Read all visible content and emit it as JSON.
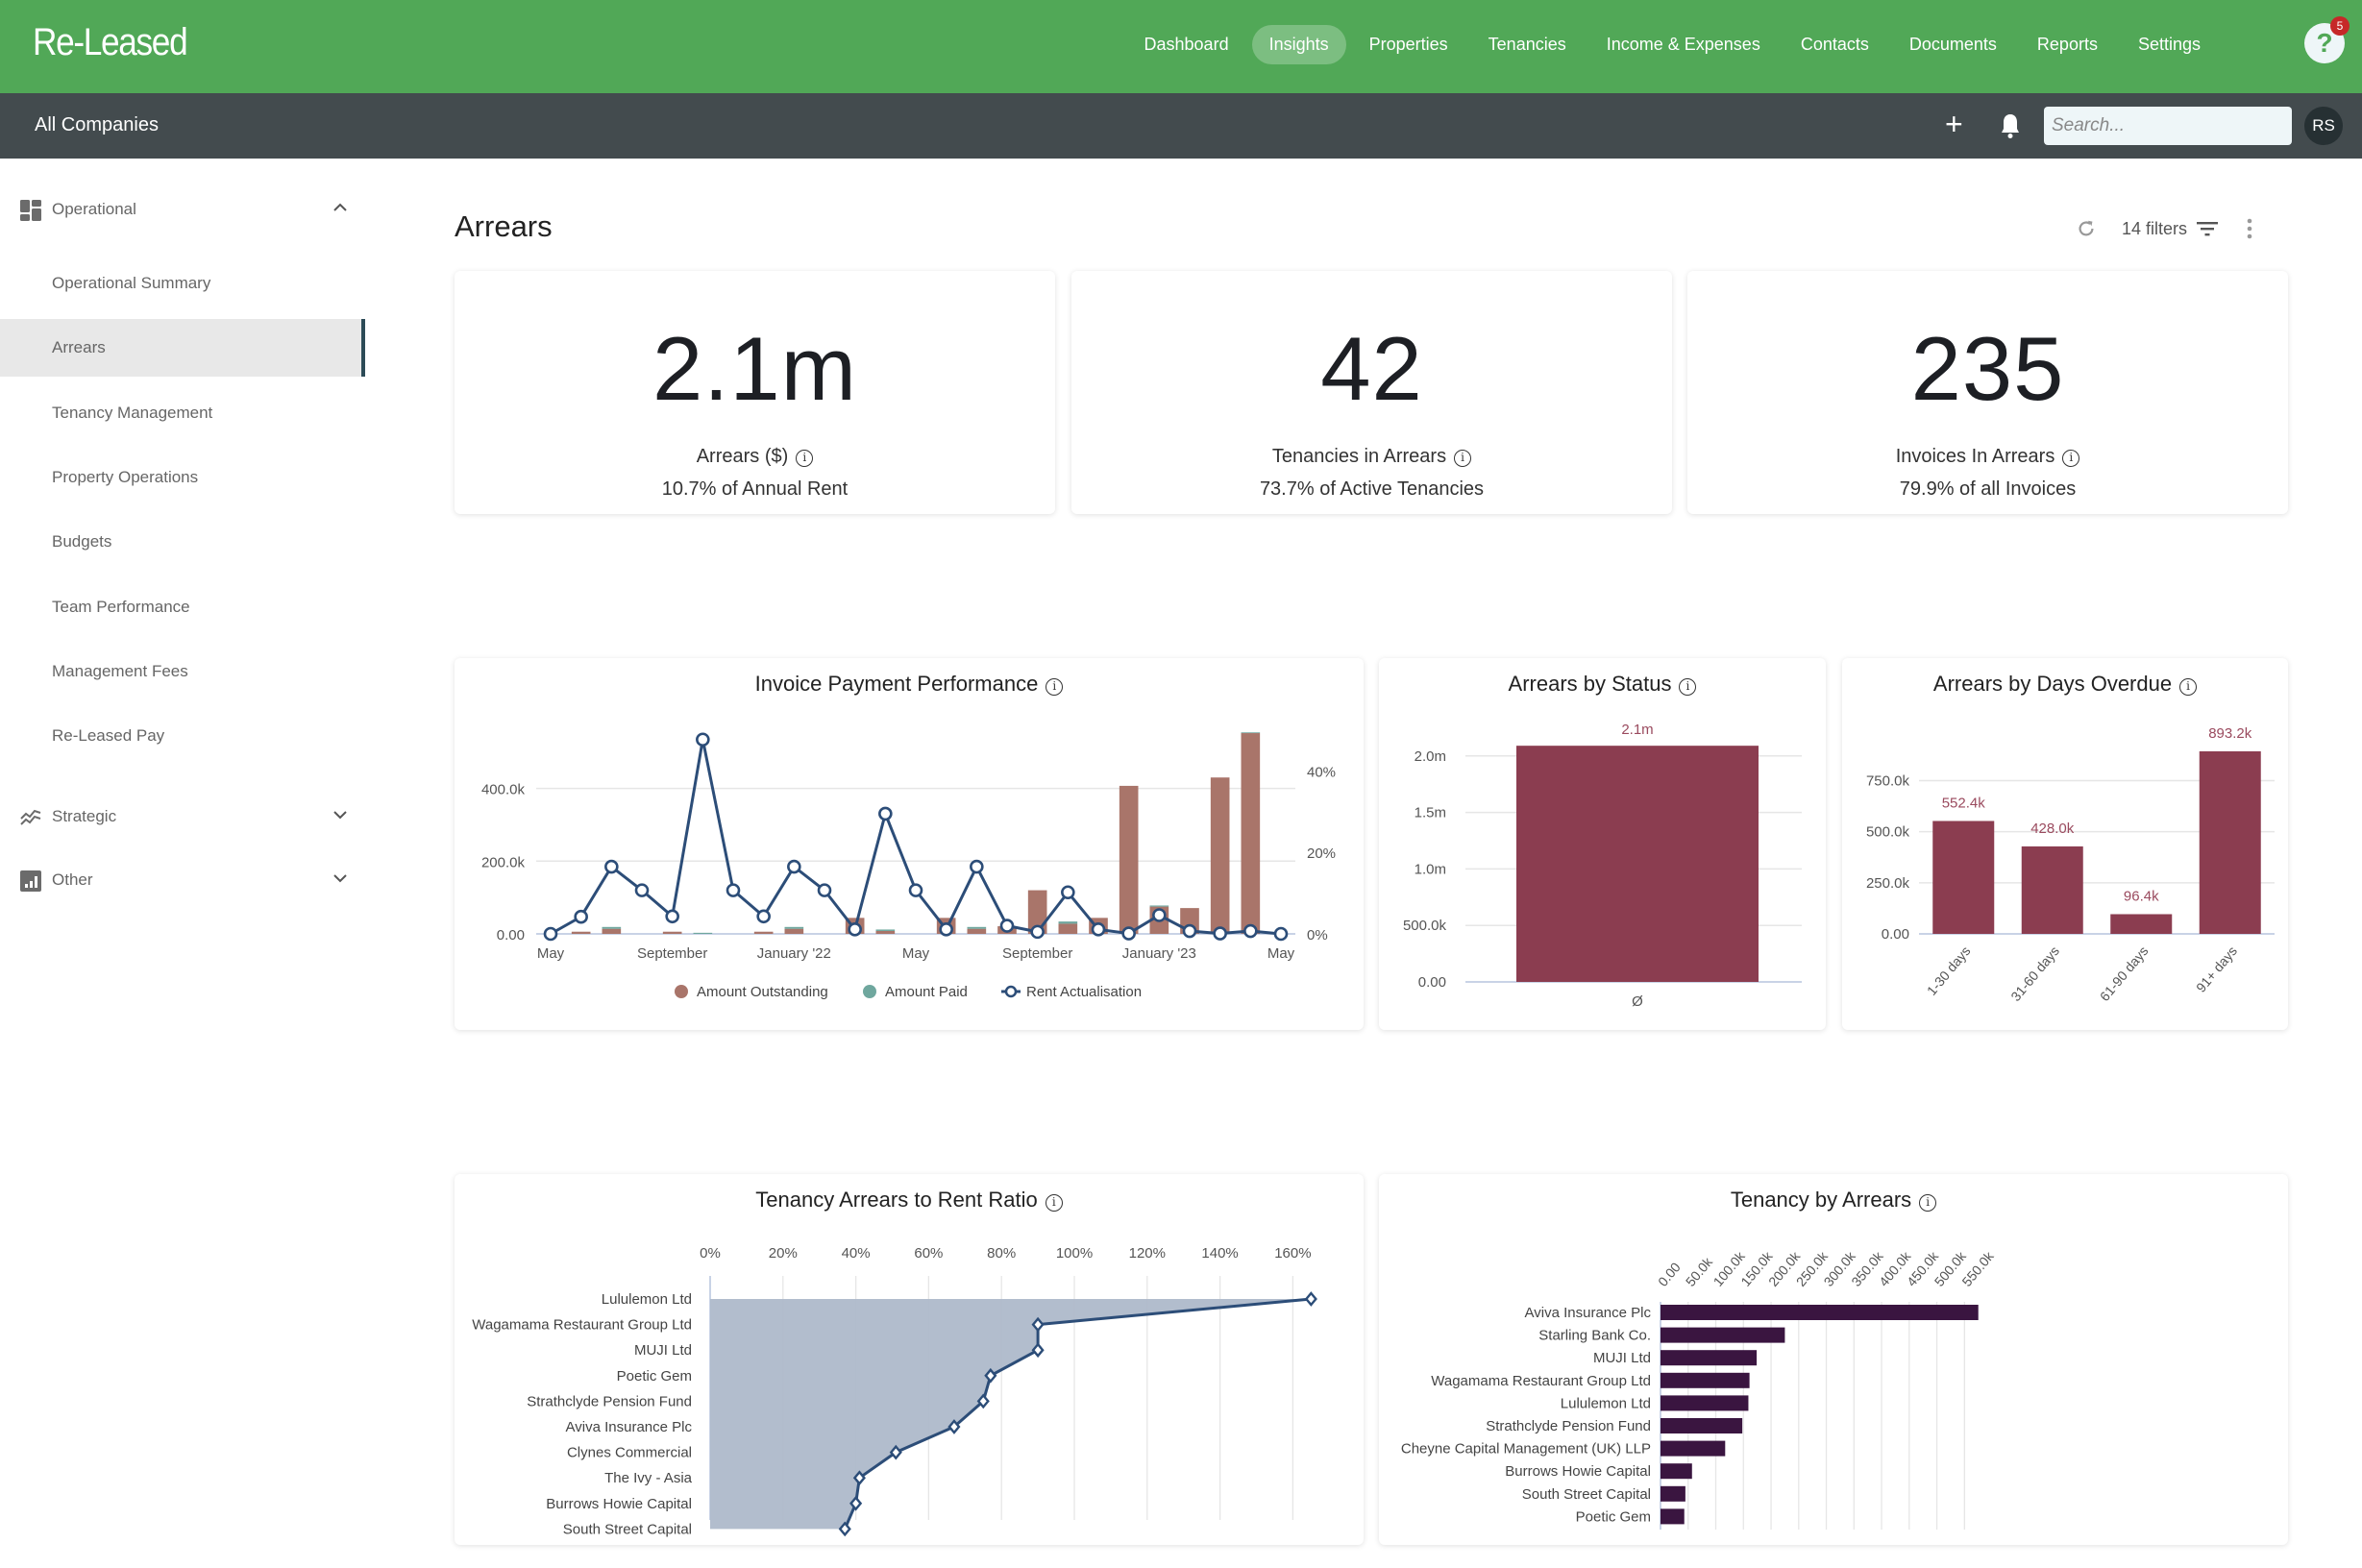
{
  "app": {
    "logo": "Re-Leased",
    "nav": [
      {
        "label": "Dashboard",
        "active": false
      },
      {
        "label": "Insights",
        "active": true
      },
      {
        "label": "Properties",
        "active": false
      },
      {
        "label": "Tenancies",
        "active": false
      },
      {
        "label": "Income & Expenses",
        "active": false
      },
      {
        "label": "Contacts",
        "active": false
      },
      {
        "label": "Documents",
        "active": false
      },
      {
        "label": "Reports",
        "active": false
      },
      {
        "label": "Settings",
        "active": false
      }
    ],
    "help_icon": "question-icon",
    "help_badge": "5",
    "company": "All Companies",
    "add_icon": "plus-icon",
    "bell_icon": "bell-icon",
    "search_placeholder": "Search...",
    "avatar_initials": "RS",
    "colors": {
      "header": "#51a857",
      "subbar": "#434b4e",
      "accent_dark": "#2c4b57"
    }
  },
  "sidebar": {
    "groups": [
      {
        "label": "Operational",
        "icon": "dashboard-icon",
        "expanded": true,
        "items": [
          {
            "label": "Operational Summary",
            "active": false
          },
          {
            "label": "Arrears",
            "active": true
          },
          {
            "label": "Tenancy Management",
            "active": false
          },
          {
            "label": "Property Operations",
            "active": false
          },
          {
            "label": "Budgets",
            "active": false
          },
          {
            "label": "Team Performance",
            "active": false
          },
          {
            "label": "Management Fees",
            "active": false
          },
          {
            "label": "Re-Leased Pay",
            "active": false
          }
        ]
      },
      {
        "label": "Strategic",
        "icon": "trend-icon",
        "expanded": false
      },
      {
        "label": "Other",
        "icon": "bar-chart-icon",
        "expanded": false
      }
    ]
  },
  "page": {
    "title": "Arrears",
    "filters_label": "14 filters"
  },
  "kpis": [
    {
      "value": "2.1m",
      "label": "Arrears ($)",
      "sub": "10.7% of Annual Rent"
    },
    {
      "value": "42",
      "label": "Tenancies in Arrears",
      "sub": "73.7% of Active Tenancies"
    },
    {
      "value": "235",
      "label": "Invoices In Arrears",
      "sub": "79.9% of all Invoices"
    }
  ],
  "chart_data": [
    {
      "id": "invoice_payment_performance",
      "type": "bar",
      "title": "Invoice Payment Performance",
      "x": [
        "May 2021",
        "Jun 2021",
        "Jul 2021",
        "Aug 2021",
        "Sep 2021",
        "Oct 2021",
        "Nov 2021",
        "Dec 2021",
        "Jan 2022",
        "Feb 2022",
        "Mar 2022",
        "Apr 2022",
        "May 2022",
        "Jun 2022",
        "Jul 2022",
        "Aug 2022",
        "Sep 2022",
        "Oct 2022",
        "Nov 2022",
        "Dec 2022",
        "Jan 2023",
        "Feb 2023",
        "Mar 2023",
        "Apr 2023",
        "May 2023"
      ],
      "x_tick_labels": [
        {
          "index": 0,
          "label": "May"
        },
        {
          "index": 4,
          "label": "September"
        },
        {
          "index": 8,
          "label": "January '22"
        },
        {
          "index": 12,
          "label": "May"
        },
        {
          "index": 16,
          "label": "September"
        },
        {
          "index": 20,
          "label": "January '23"
        },
        {
          "index": 24,
          "label": "May"
        }
      ],
      "y_left": {
        "ticks": [
          "0.00",
          "200.0k",
          "400.0k"
        ],
        "range": [
          0,
          560000
        ]
      },
      "y_right": {
        "ticks": [
          "0%",
          "20%",
          "40%"
        ],
        "range": [
          0,
          50
        ]
      },
      "series": [
        {
          "name": "Amount Outstanding",
          "kind": "bar",
          "stack": "a",
          "axis": "left",
          "color": "#a9756a",
          "values": [
            0,
            6000,
            14000,
            0,
            6000,
            0,
            0,
            6000,
            14000,
            0,
            44000,
            8000,
            0,
            44000,
            14000,
            21000,
            120000,
            28000,
            44000,
            407000,
            75000,
            71000,
            430000,
            552000,
            0
          ]
        },
        {
          "name": "Amount Paid",
          "kind": "bar",
          "stack": "a",
          "axis": "left",
          "color": "#6fa79e",
          "values": [
            0,
            0,
            5000,
            0,
            0,
            3000,
            0,
            0,
            5000,
            0,
            0,
            4000,
            0,
            0,
            5000,
            0,
            0,
            6000,
            0,
            0,
            3000,
            0,
            0,
            2000,
            0
          ]
        },
        {
          "name": "Rent Actualisation",
          "kind": "line",
          "axis": "right",
          "color": "#2c4d78",
          "unit": "%",
          "values": [
            0,
            4.2,
            16.5,
            10.7,
            4.3,
            47.7,
            10.7,
            4.3,
            16.5,
            10.7,
            1.1,
            29.5,
            10.7,
            1.1,
            16.5,
            2.0,
            0.5,
            10.2,
            1.1,
            0.1,
            4.6,
            0.7,
            0.1,
            0.7,
            0
          ]
        }
      ],
      "legend": "bottom"
    },
    {
      "id": "arrears_by_status",
      "type": "bar",
      "title": "Arrears by Status",
      "categories": [
        "Ø"
      ],
      "values": [
        2090000
      ],
      "data_labels": [
        "2.1m"
      ],
      "y_ticks": [
        "0.00",
        "500.0k",
        "1.0m",
        "1.5m",
        "2.0m"
      ],
      "ylim": [
        0,
        2100000
      ],
      "color": "#8b3d50"
    },
    {
      "id": "arrears_by_days_overdue",
      "type": "bar",
      "title": "Arrears by Days Overdue",
      "categories": [
        "1-30 days",
        "31-60 days",
        "61-90 days",
        "91+ days"
      ],
      "values": [
        552400,
        428000,
        96400,
        893200
      ],
      "data_labels": [
        "552.4k",
        "428.0k",
        "96.4k",
        "893.2k"
      ],
      "y_ticks": [
        "0.00",
        "250.0k",
        "500.0k",
        "750.0k"
      ],
      "ylim": [
        0,
        893200
      ],
      "color": "#8b3d50"
    },
    {
      "id": "tenancy_arrears_to_rent_ratio",
      "type": "area",
      "title": "Tenancy Arrears to Rent Ratio",
      "categories": [
        "Lululemon Ltd",
        "Wagamama Restaurant Group Ltd",
        "MUJI Ltd",
        "Poetic Gem",
        "Strathclyde Pension Fund",
        "Aviva Insurance Plc",
        "Clynes Commercial",
        "The Ivy - Asia",
        "Burrows Howie Capital",
        "South Street Capital"
      ],
      "values": [
        165,
        90,
        90,
        77,
        75,
        67,
        51,
        41,
        40,
        37
      ],
      "x_ticks": [
        "0%",
        "20%",
        "40%",
        "60%",
        "80%",
        "100%",
        "120%",
        "140%",
        "160%"
      ],
      "xlim": [
        0,
        165
      ],
      "fill": "#aeb9ca",
      "color": "#2c4d78"
    },
    {
      "id": "tenancy_by_arrears",
      "type": "bar",
      "orientation": "horizontal",
      "title": "Tenancy by Arrears",
      "categories": [
        "Aviva Insurance Plc",
        "Starling Bank Co.",
        "MUJI Ltd",
        "Wagamama Restaurant Group Ltd",
        "Lululemon Ltd",
        "Strathclyde Pension Fund",
        "Cheyne Capital Management (UK) LLP",
        "Burrows Howie Capital",
        "South Street Capital",
        "Poetic Gem"
      ],
      "values": [
        575000,
        225000,
        174000,
        161000,
        159000,
        148000,
        117000,
        57000,
        45000,
        43000
      ],
      "x_ticks": [
        "0.00",
        "50.0k",
        "100.0k",
        "150.0k",
        "200.0k",
        "250.0k",
        "300.0k",
        "350.0k",
        "400.0k",
        "450.0k",
        "500.0k",
        "550.0k"
      ],
      "xlim": [
        0,
        575000
      ],
      "color": "#3a1540"
    }
  ]
}
